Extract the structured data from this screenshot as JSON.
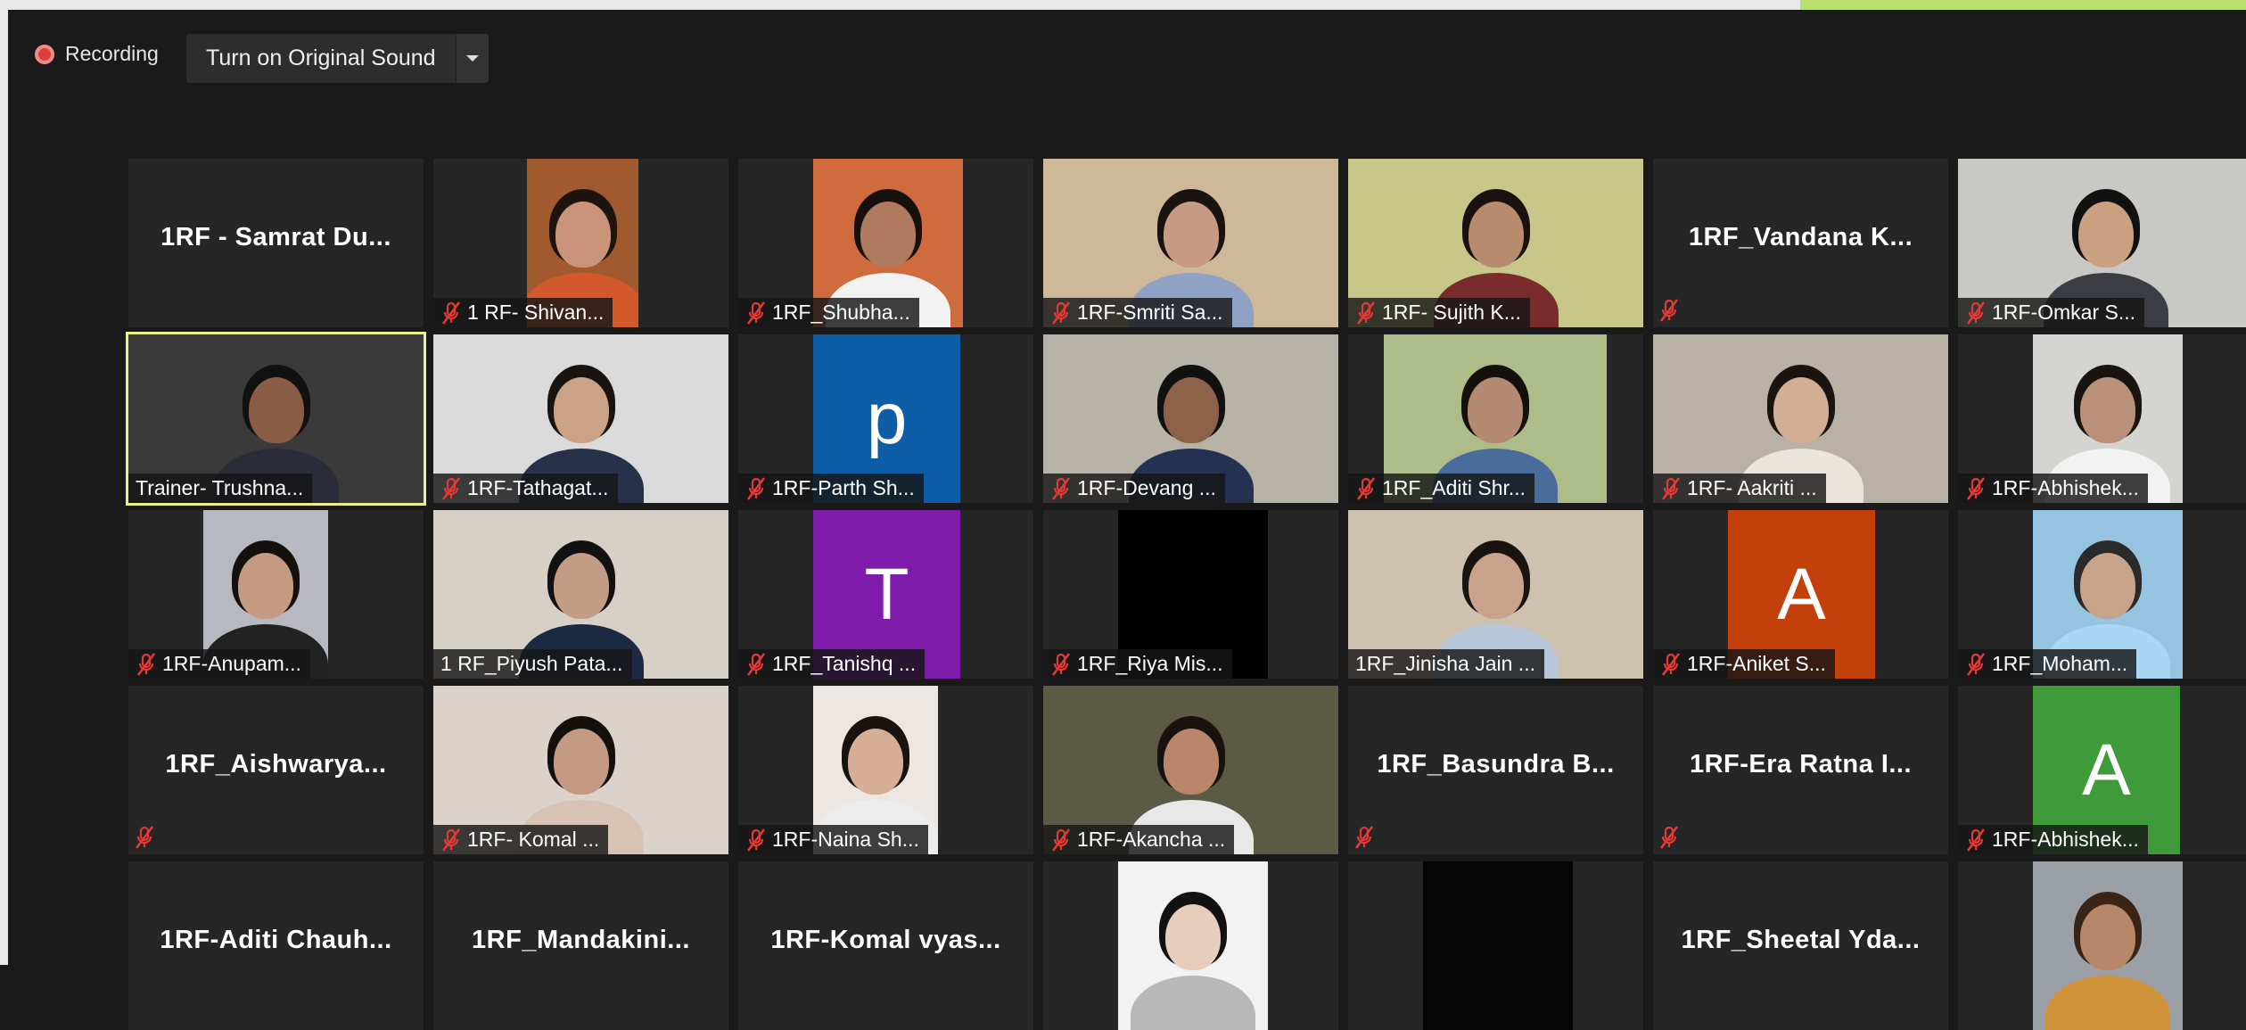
{
  "recording": {
    "label": "Recording"
  },
  "toolbar": {
    "original_sound_label": "Turn on Original Sound"
  },
  "colors": {
    "active_speaker_border": "#ecf08a",
    "mute_icon": "#e53935",
    "record_dot": "#d8403b"
  },
  "icons": {
    "muted": "microphone-muted-icon",
    "recording": "record-dot-icon",
    "dropdown": "chevron-down-icon"
  },
  "participants": [
    {
      "name": "1RF - Samrat Du...",
      "video": false,
      "muted": false
    },
    {
      "name": "1 RF- Shivan...",
      "video": true,
      "muted": true
    },
    {
      "name": "1RF_Shubha...",
      "video": true,
      "muted": true
    },
    {
      "name": "1RF-Smriti Sa...",
      "video": true,
      "muted": true
    },
    {
      "name": "1RF- Sujith K...",
      "video": true,
      "muted": true
    },
    {
      "name": "1RF_Vandana K...",
      "video": false,
      "muted": true
    },
    {
      "name": "1RF-Omkar S...",
      "video": true,
      "muted": true
    },
    {
      "name": "Trainer- Trushna...",
      "video": true,
      "muted": false,
      "active_speaker": true
    },
    {
      "name": "1RF-Tathagat...",
      "video": true,
      "muted": true
    },
    {
      "name": "1RF-Parth Sh...",
      "video": false,
      "muted": true,
      "avatar_letter": "p",
      "avatar_color": "#0d5ea6"
    },
    {
      "name": "1RF-Devang ...",
      "video": true,
      "muted": true
    },
    {
      "name": "1RF_Aditi Shr...",
      "video": true,
      "muted": true
    },
    {
      "name": "1RF- Aakriti ...",
      "video": true,
      "muted": true
    },
    {
      "name": "1RF-Abhishek...",
      "video": true,
      "muted": true
    },
    {
      "name": "1RF-Anupam...",
      "video": true,
      "muted": true
    },
    {
      "name": "1 RF_Piyush Pata...",
      "video": true,
      "muted": false
    },
    {
      "name": "1RF_Tanishq ...",
      "video": false,
      "muted": true,
      "avatar_letter": "T",
      "avatar_color": "#7e1bab"
    },
    {
      "name": "1RF_Riya Mis...",
      "video": true,
      "muted": true
    },
    {
      "name": "1RF_Jinisha Jain ...",
      "video": true,
      "muted": false
    },
    {
      "name": "1RF-Aniket S...",
      "video": false,
      "muted": true,
      "avatar_letter": "A",
      "avatar_color": "#c3400c"
    },
    {
      "name": "1RF_Moham...",
      "video": true,
      "muted": true
    },
    {
      "name": "1RF_Aishwarya...",
      "video": false,
      "muted": true
    },
    {
      "name": "1RF- Komal ...",
      "video": true,
      "muted": true
    },
    {
      "name": "1RF-Naina Sh...",
      "video": true,
      "muted": true
    },
    {
      "name": "1RF-Akancha ...",
      "video": true,
      "muted": true
    },
    {
      "name": "1RF_Basundra B...",
      "video": false,
      "muted": true
    },
    {
      "name": "1RF-Era Ratna I...",
      "video": false,
      "muted": true
    },
    {
      "name": "1RF-Abhishek...",
      "video": false,
      "muted": true,
      "avatar_letter": "A",
      "avatar_color": "#3f9a3a"
    },
    {
      "name": "1RF-Aditi Chauh...",
      "video": false,
      "muted": false
    },
    {
      "name": "1RF_Mandakini...",
      "video": false,
      "muted": false
    },
    {
      "name": "1RF-Komal vyas...",
      "video": false,
      "muted": false
    },
    {
      "name": "",
      "video": true,
      "muted": false
    },
    {
      "name": "",
      "video": true,
      "muted": false
    },
    {
      "name": "1RF_Sheetal Yda...",
      "video": false,
      "muted": false
    },
    {
      "name": "",
      "video": true,
      "muted": false
    }
  ]
}
